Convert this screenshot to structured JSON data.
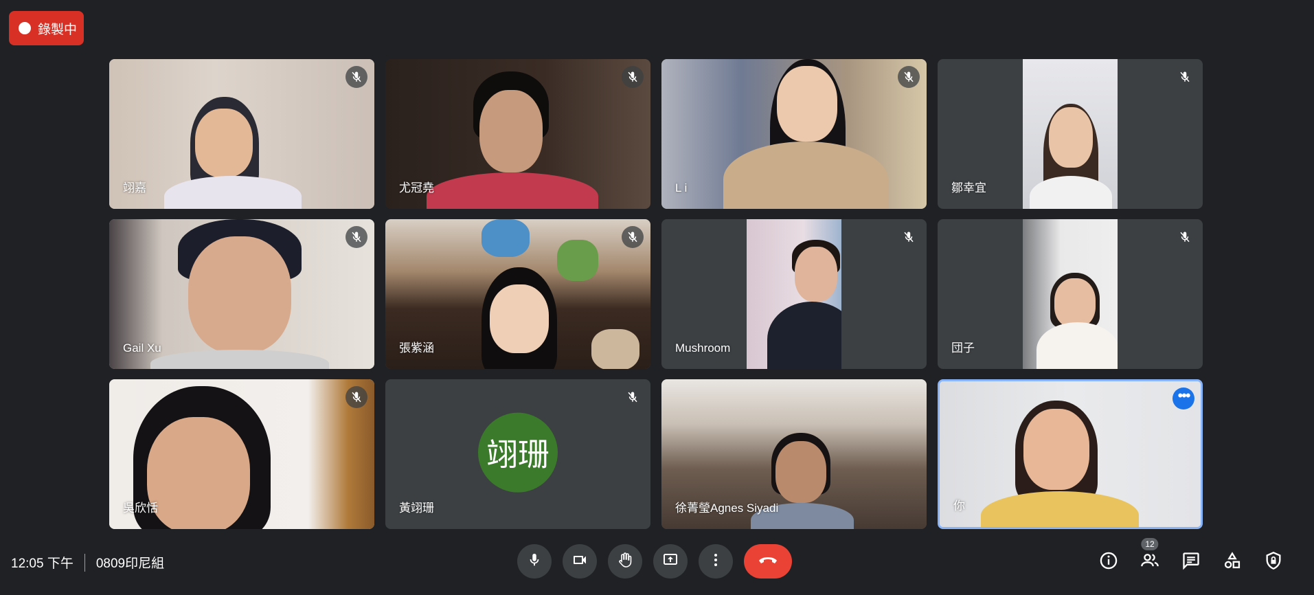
{
  "recording": {
    "label": "錄製中"
  },
  "tiles": [
    {
      "name": "翊嘉",
      "muted": true
    },
    {
      "name": "尤冠堯",
      "muted": true
    },
    {
      "name": "L i",
      "muted": true
    },
    {
      "name": "鄒幸宜",
      "muted": true
    },
    {
      "name": "Gail Xu",
      "muted": true
    },
    {
      "name": "張紫涵",
      "muted": true
    },
    {
      "name": "Mushroom",
      "muted": true
    },
    {
      "name": "団子",
      "muted": true
    },
    {
      "name": "吳欣恬",
      "muted": true
    },
    {
      "name": "黃翊珊",
      "muted": true,
      "avatar": "翊珊",
      "avatar_color": "#3a7a2a"
    },
    {
      "name": "徐菁瑩Agnes Siyadi",
      "muted": false
    },
    {
      "name": "你",
      "muted": false,
      "self": true
    }
  ],
  "meeting": {
    "time": "12:05 下午",
    "code": "0809印尼組"
  },
  "participants": {
    "count": "12"
  },
  "colors": {
    "accent": "#1a73e8",
    "hangup": "#ea4335",
    "recording": "#d93025"
  }
}
